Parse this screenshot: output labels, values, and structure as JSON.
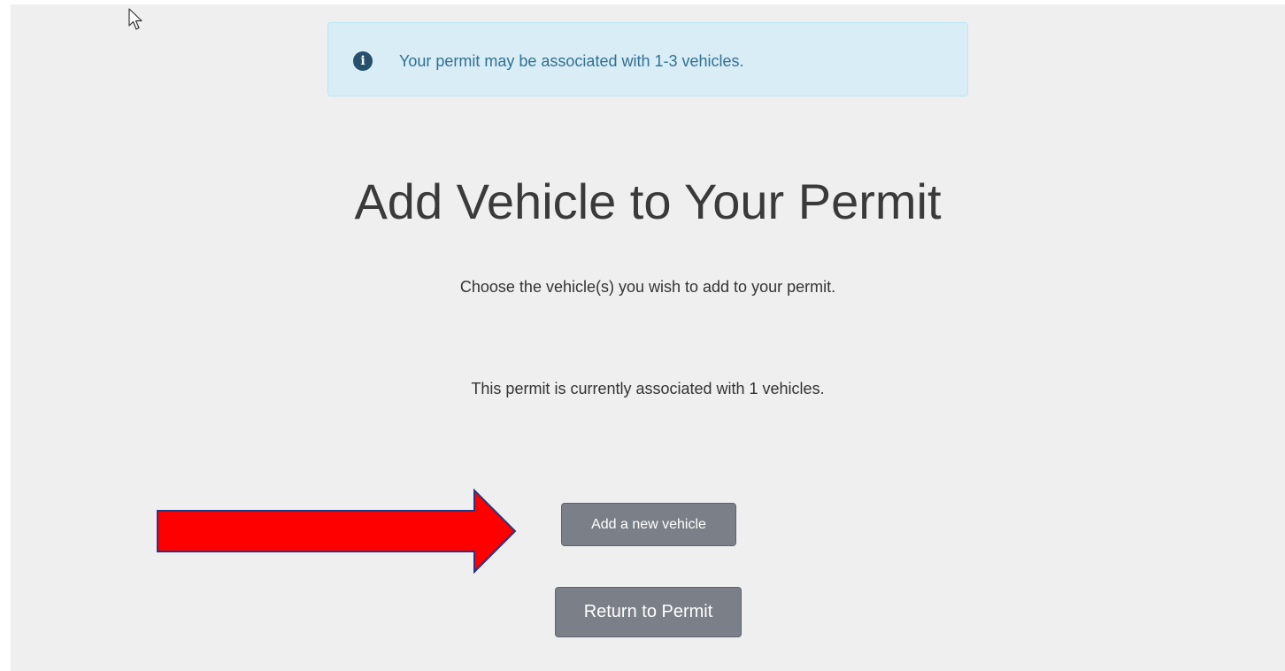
{
  "alert": {
    "icon": "info-icon",
    "text": "Your permit may be associated with 1-3 vehicles.",
    "color": "#31708f",
    "background": "#d9edf7"
  },
  "main": {
    "title": "Add Vehicle to Your Permit",
    "subtitle": "Choose the vehicle(s) you wish to add to your permit.",
    "status": "This permit is currently associated with 1 vehicles."
  },
  "actions": {
    "add_label": "Add a new vehicle",
    "return_label": "Return to Permit",
    "button_color": "#7b8088"
  },
  "annotation": {
    "icon": "right-arrow-icon",
    "color": "#ff0000"
  },
  "cursor": {
    "icon": "mouse-pointer-icon"
  }
}
